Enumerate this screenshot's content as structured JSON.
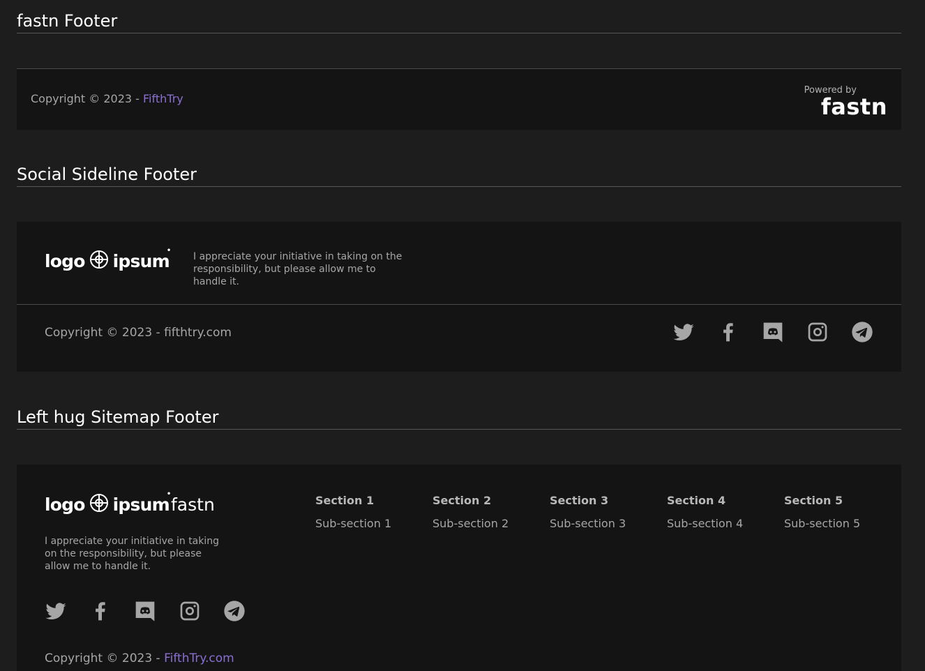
{
  "sections": {
    "fastn_footer": {
      "heading": "fastn Footer",
      "copyright_prefix": "Copyright © 2023 - ",
      "copyright_link": "FifthTry",
      "powered_by": "Powered by",
      "powered_brand": "fastn"
    },
    "social_sideline_footer": {
      "heading": "Social Sideline Footer",
      "logo_word1": "logo",
      "logo_word2": "ipsum",
      "description": "I appreciate your initiative in taking on the responsibility, but please allow me to handle it.",
      "copyright": "Copyright © 2023 - fifthtry.com",
      "social_icons": [
        "twitter-icon",
        "facebook-icon",
        "discord-icon",
        "instagram-icon",
        "telegram-icon"
      ]
    },
    "left_hug_sitemap_footer": {
      "heading": "Left hug Sitemap Footer",
      "logo_word1": "logo",
      "logo_word2": "ipsum",
      "brand": "fastn",
      "description": "I appreciate your initiative in taking on the responsibility, but please allow me to handle it.",
      "social_icons": [
        "twitter-icon",
        "facebook-icon",
        "discord-icon",
        "instagram-icon",
        "telegram-icon"
      ],
      "sitemap": [
        {
          "title": "Section 1",
          "item": "Sub-section 1"
        },
        {
          "title": "Section 2",
          "item": "Sub-section 2"
        },
        {
          "title": "Section 3",
          "item": "Sub-section 3"
        },
        {
          "title": "Section 4",
          "item": "Sub-section 4"
        },
        {
          "title": "Section 5",
          "item": "Sub-section 5"
        }
      ],
      "copyright_prefix": "Copyright © 2023 - ",
      "copyright_link": "FifthTry.com"
    }
  },
  "colors": {
    "background": "#1d1d1d",
    "panel": "#141414",
    "link": "#8a6fd1",
    "muted_text": "#a6a6a6"
  }
}
